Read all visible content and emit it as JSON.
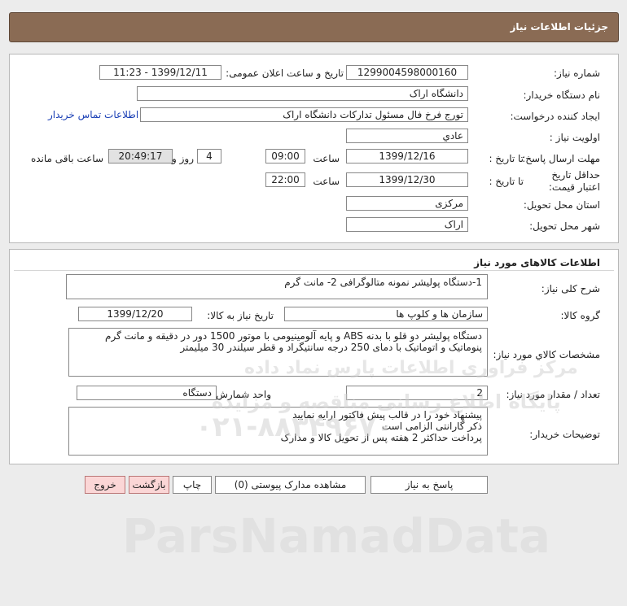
{
  "header": {
    "title": "جزئیات اطلاعات نیاز"
  },
  "info": {
    "need_number_label": "شماره نیاز:",
    "need_number": "1299004598000160",
    "announce_label": "تاریخ و ساعت اعلان عمومی:",
    "announce_value": "1399/12/11 - 11:23",
    "buyer_org_label": "نام دستگاه خریدار:",
    "buyer_org": "دانشگاه اراک",
    "requester_label": "ایجاد کننده درخواست:",
    "requester": "تورج فرخ فال مسئول تدارکات دانشگاه اراک",
    "contact_link": "اطلاعات تماس خریدار",
    "priority_label": "اولویت نیاز :",
    "priority": "عادي",
    "deadline_label": "مهلت ارسال پاسخ:",
    "deadline_to": "تا تاریخ :",
    "deadline_date": "1399/12/16",
    "time_label": "ساعت",
    "deadline_time": "09:00",
    "days_count": "4",
    "days_label": "روز و",
    "remaining_time": "20:49:17",
    "remaining_label": "ساعت باقی مانده",
    "validity_label": "حداقل تاریخ اعتبار قیمت:",
    "validity_to": "تا تاریخ :",
    "validity_date": "1399/12/30",
    "validity_time_label": "ساعت",
    "validity_time": "22:00",
    "province_label": "استان محل تحویل:",
    "province": "مرکزی",
    "city_label": "شهر محل تحویل:",
    "city": "اراک"
  },
  "goods": {
    "section_title": "اطلاعات کالاهای مورد نیاز",
    "summary_label": "شرح کلی نیاز:",
    "summary": "1-دستگاه پولیشر نمونه متالوگرافی 2- مانت گرم",
    "group_label": "گروه کالا:",
    "group": "سازمان ها و کلوپ ها",
    "need_date_label": "تاریخ نیاز به کالا:",
    "need_date": "1399/12/20",
    "specs_label": "مشخصات کالاي مورد نیاز:",
    "specs": "دستگاه پولیشر دو قلو با بدنه ABS و پایه آلومینیومی با موتور 1500 دور در دقیقه و مانت گرم پنوماتیک و اتوماتیک با دمای 250 درجه سانتیگراد و قطر سیلندر 30 میلیمتر",
    "qty_label": "تعداد / مقدار مورد نیاز:",
    "qty": "2",
    "unit_label": "واحد شمارش:",
    "unit": "دستگاه",
    "notes_label": "توضیحات خریدار:",
    "notes": [
      "پیشنهاد خود را در قالب پیش فاکتور ارایه نمایید",
      "ذکر گارانتی الزامی است",
      "پرداخت حداکثر 2 هفته پس از تحویل کالا و مدارک"
    ]
  },
  "buttons": {
    "reply": "پاسخ به نیاز",
    "attachments": "مشاهده مدارک پیوستی (0)",
    "print": "چاپ",
    "back": "بازگشت",
    "exit": "خروج"
  },
  "watermark": {
    "brand": "ParsNamadData",
    "line1": "مرکز فراوری اطلاعات پارس نماد داده",
    "line2": "پایگاه اطلاع رسانی مناقصه و مزایده",
    "phone": "۰۲۱-۸۸۳۴۹۶۷۰"
  }
}
